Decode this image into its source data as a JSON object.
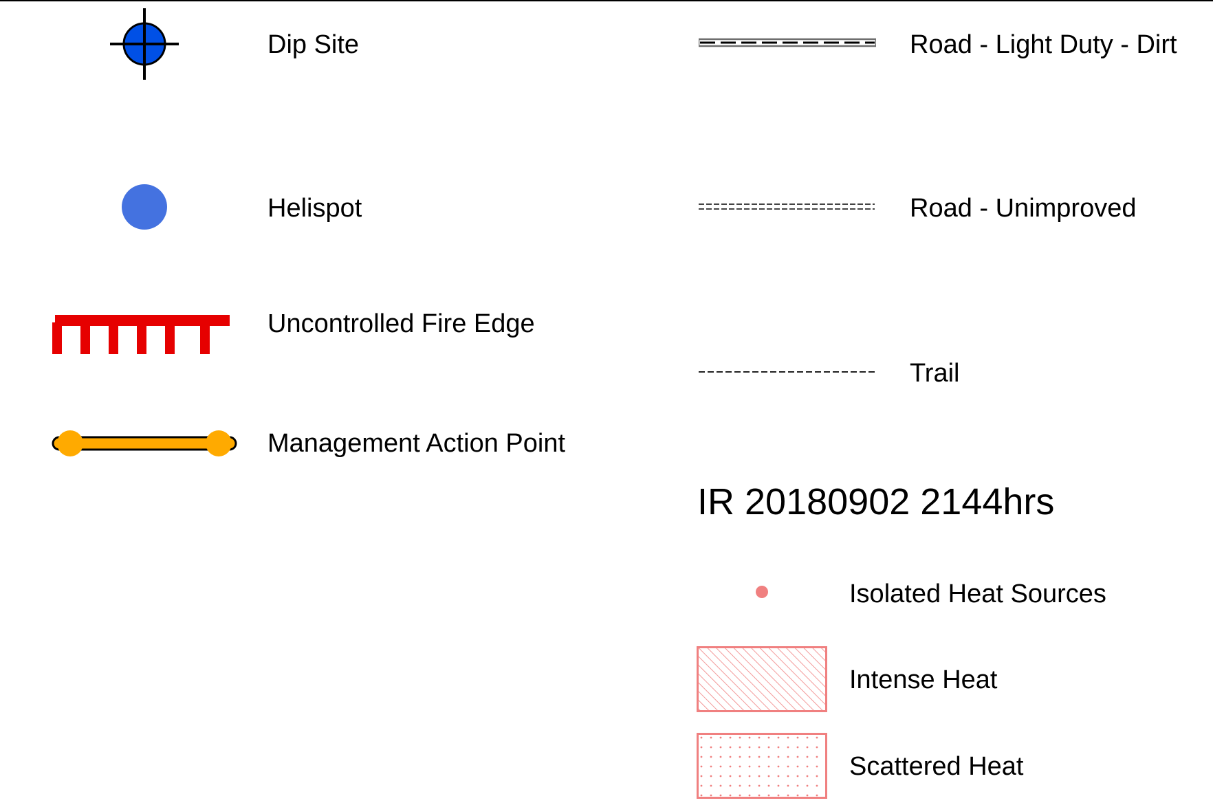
{
  "legend": {
    "left_items": [
      {
        "label": "Dip Site",
        "icon": "dip-site-crosshair-icon",
        "color": "#0050E6"
      },
      {
        "label": "Helispot",
        "icon": "helispot-circle-icon",
        "color": "#4472E0"
      },
      {
        "label": "Uncontrolled Fire Edge",
        "icon": "uncontrolled-fire-edge-line",
        "color": "#E60000"
      },
      {
        "label": "Management Action Point",
        "icon": "management-action-point-line",
        "color": "#FFAA00"
      }
    ],
    "right_items": [
      {
        "label": "Road - Light Duty - Dirt",
        "icon": "road-light-duty-dirt-line",
        "color": "#6E6E6E"
      },
      {
        "label": "Road - Unimproved",
        "icon": "road-unimproved-line",
        "color": "#6E6E6E"
      },
      {
        "label": "Trail",
        "icon": "trail-line",
        "color": "#000000"
      }
    ],
    "ir_section": {
      "title": "IR 20180902 2144hrs",
      "items": [
        {
          "label": "Isolated Heat Sources",
          "icon": "isolated-heat-dot-icon",
          "color": "#F08080"
        },
        {
          "label": "Intense Heat",
          "icon": "intense-heat-hatch-swatch",
          "color": "#F08080"
        },
        {
          "label": "Scattered Heat",
          "icon": "scattered-heat-dot-swatch",
          "color": "#F08080"
        }
      ]
    }
  }
}
